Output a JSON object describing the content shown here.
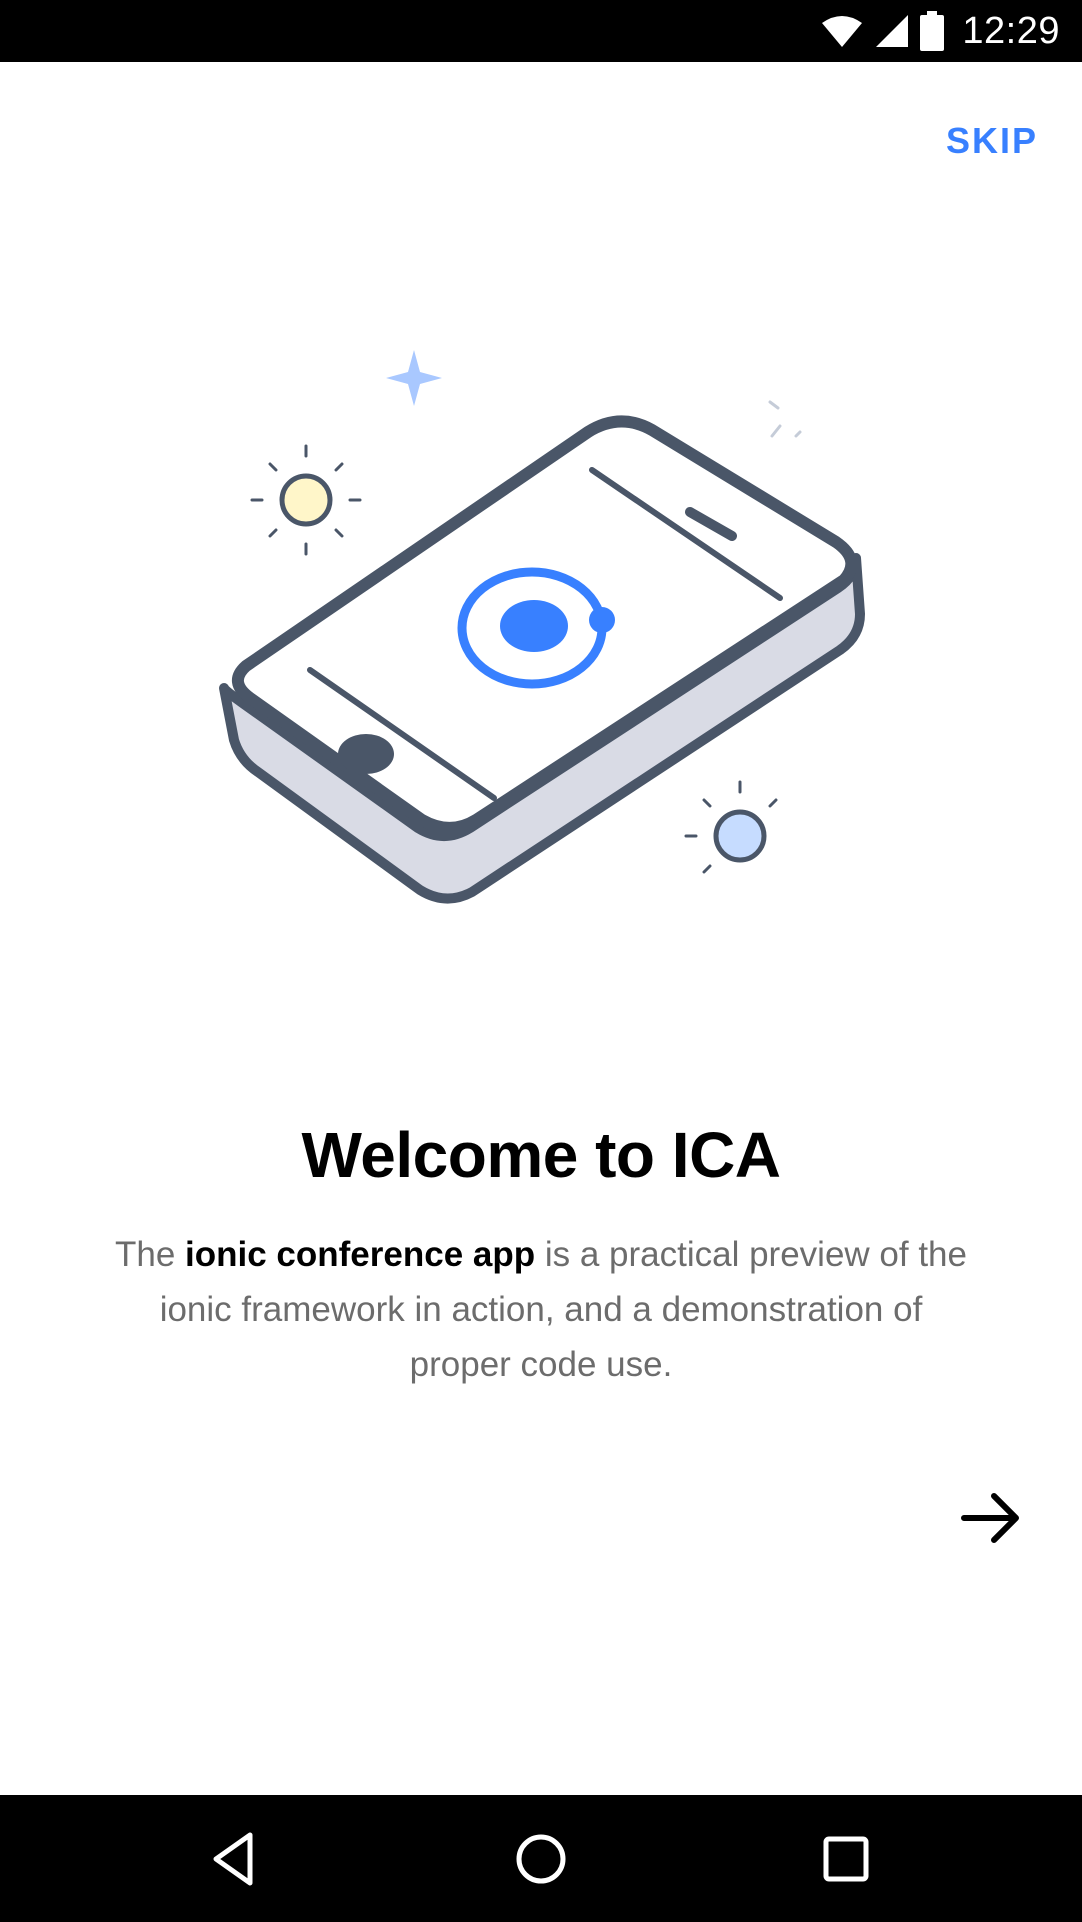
{
  "status_bar": {
    "time": "12:29",
    "icons": [
      "wifi-icon",
      "cell-signal-icon",
      "battery-icon"
    ]
  },
  "skip_label": "SKIP",
  "slide": {
    "title": "Welcome to ICA",
    "description_prefix": "The ",
    "description_emphasis": "ionic conference app",
    "description_suffix": " is a practical preview of the ionic framework in action, and a demonstration of proper code use."
  },
  "next_icon": "arrow-forward-icon",
  "nav_bar": {
    "icons": [
      "back-triangle-icon",
      "home-circle-icon",
      "recents-square-icon"
    ]
  },
  "colors": {
    "accent": "#3880ff",
    "phone_outline": "#4a5668",
    "phone_side": "#d9dbe5",
    "sun_yellow": "#fff6c9",
    "sun_blue": "#c6dcff"
  }
}
